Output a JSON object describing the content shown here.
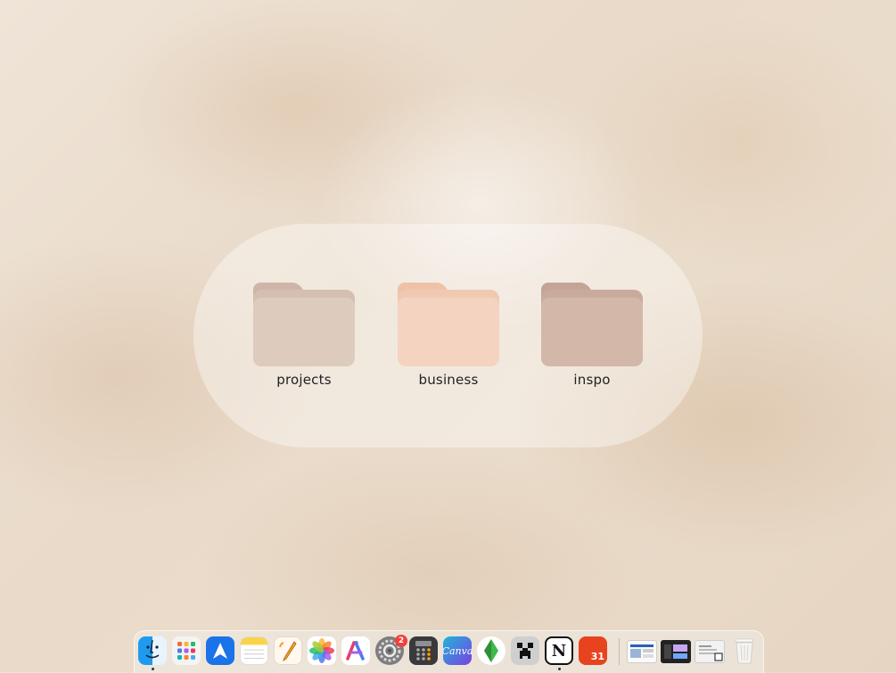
{
  "widget": {
    "folders": [
      {
        "name": "projects",
        "tab_color": "#cdb6a8",
        "back_color": "#d4bfb1",
        "front_color": "#ddcbbe"
      },
      {
        "name": "business",
        "tab_color": "#efc2a8",
        "back_color": "#f0c9b2",
        "front_color": "#f4d4c0"
      },
      {
        "name": "inspo",
        "tab_color": "#c4a496",
        "back_color": "#c9ab9d",
        "front_color": "#d3b7a9"
      }
    ]
  },
  "dock": {
    "apps": [
      {
        "id": "finder",
        "icon": "finder-icon",
        "running": true
      },
      {
        "id": "launchpad",
        "icon": "launchpad-icon",
        "running": false
      },
      {
        "id": "spark",
        "icon": "paper-plane-icon",
        "running": false
      },
      {
        "id": "notes",
        "icon": "notes-icon",
        "running": false
      },
      {
        "id": "pages",
        "icon": "pen-icon",
        "running": false
      },
      {
        "id": "photos",
        "icon": "photos-flower-icon",
        "running": false
      },
      {
        "id": "creative",
        "icon": "colorful-a-icon",
        "running": false
      },
      {
        "id": "settings",
        "icon": "gear-icon",
        "running": false,
        "badge": "2"
      },
      {
        "id": "calculator",
        "icon": "calculator-icon",
        "running": false
      },
      {
        "id": "canva",
        "icon": "canva-icon",
        "label": "Canva",
        "running": false
      },
      {
        "id": "sims",
        "icon": "plumbob-icon",
        "running": false
      },
      {
        "id": "minecraft",
        "icon": "creeper-icon",
        "running": false
      },
      {
        "id": "notion",
        "icon": "notion-icon",
        "label": "N",
        "running": true
      },
      {
        "id": "calendar",
        "icon": "calendar-icon",
        "label": "31",
        "running": false
      }
    ],
    "recent_windows": [
      "window-thumbnail-1",
      "window-thumbnail-2",
      "window-thumbnail-3"
    ],
    "trash": {
      "icon": "trash-icon"
    }
  },
  "colors": {
    "badge": "#f0413a",
    "canva": "#20b5d8",
    "calendar": "#e8431f",
    "spark": "#1a73e8"
  }
}
